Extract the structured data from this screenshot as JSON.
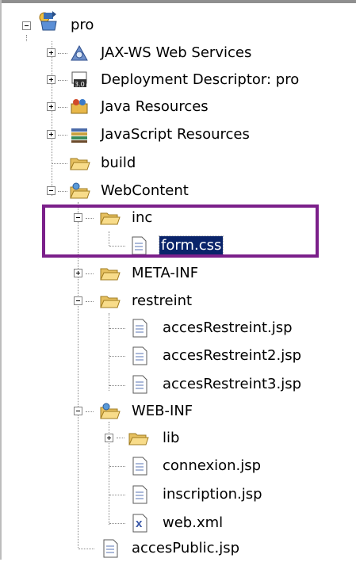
{
  "tree": {
    "root": {
      "label": "pro",
      "icon": "project-icon",
      "expanded": true
    },
    "items": [
      {
        "label": "JAX-WS Web Services",
        "icon": "web-services-icon",
        "expanded": false
      },
      {
        "label": "Deployment Descriptor: pro",
        "icon": "deployment-descriptor-icon",
        "expanded": false
      },
      {
        "label": "Java Resources",
        "icon": "java-resources-icon",
        "expanded": false
      },
      {
        "label": "JavaScript Resources",
        "icon": "javascript-resources-icon",
        "expanded": false
      },
      {
        "label": "build",
        "icon": "folder-icon"
      },
      {
        "label": "WebContent",
        "icon": "web-folder-icon",
        "expanded": true
      },
      {
        "label": "inc",
        "icon": "folder-open-icon",
        "expanded": true
      },
      {
        "label": "form.css",
        "icon": "file-icon",
        "selected": true
      },
      {
        "label": "META-INF",
        "icon": "folder-icon",
        "expanded": false
      },
      {
        "label": "restreint",
        "icon": "folder-open-icon",
        "expanded": true
      },
      {
        "label": "accesRestreint.jsp",
        "icon": "file-icon"
      },
      {
        "label": "accesRestreint2.jsp",
        "icon": "file-icon"
      },
      {
        "label": "accesRestreint3.jsp",
        "icon": "file-icon"
      },
      {
        "label": "WEB-INF",
        "icon": "web-folder-icon",
        "expanded": true
      },
      {
        "label": "lib",
        "icon": "folder-icon",
        "expanded": false
      },
      {
        "label": "connexion.jsp",
        "icon": "file-icon"
      },
      {
        "label": "inscription.jsp",
        "icon": "file-icon"
      },
      {
        "label": "web.xml",
        "icon": "xml-file-icon"
      },
      {
        "label": "accesPublic.jsp",
        "icon": "file-icon"
      }
    ]
  },
  "colors": {
    "selection_bg": "#0a246a",
    "highlight_border": "#7b1f8a",
    "folder": "#f5d67a"
  }
}
